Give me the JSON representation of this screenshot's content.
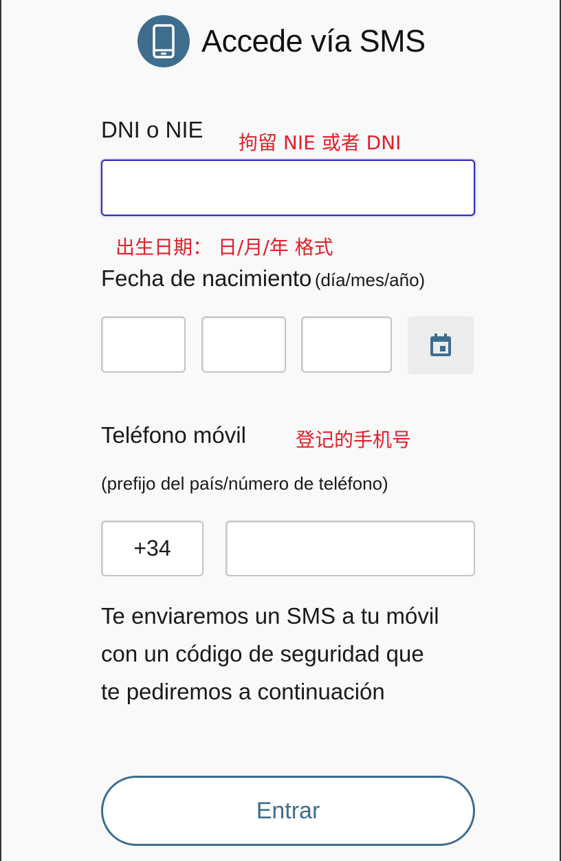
{
  "header": {
    "title": "Accede vía SMS",
    "icon": "mobile-phone-icon"
  },
  "dni": {
    "label": "DNI o NIE",
    "note": "拘留 NIE 或者 DNI",
    "value": ""
  },
  "birth": {
    "note": "出生日期： 日/月/年 格式",
    "label": "Fecha de nacimiento",
    "hint": "(día/mes/año)",
    "day": "",
    "month": "",
    "year": "",
    "calendar_icon": "calendar-icon"
  },
  "phone": {
    "label": "Teléfono móvil",
    "note": "登记的手机号",
    "hint": "(prefijo del país/número de teléfono)",
    "prefix": "+34",
    "number": ""
  },
  "info": {
    "lines": [
      "Te enviaremos un SMS a tu móvil",
      "con un código de seguridad que",
      "te pediremos a continuación"
    ]
  },
  "submit": {
    "label": "Entrar"
  },
  "colors": {
    "accent": "#3e6d8e",
    "note": "#e0202a",
    "focus": "#2d2bb8"
  }
}
